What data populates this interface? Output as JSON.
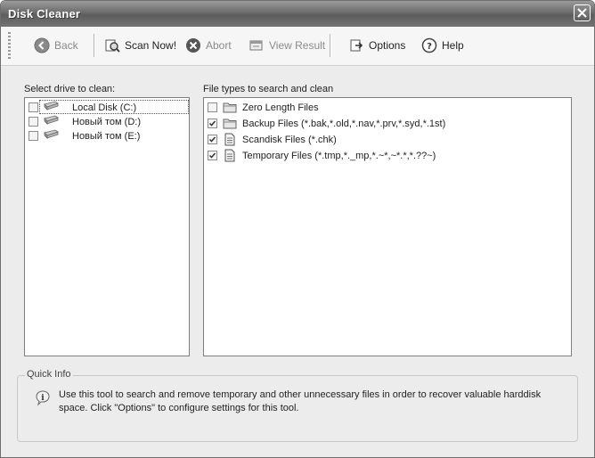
{
  "window": {
    "title": "Disk Cleaner"
  },
  "toolbar": {
    "back_label": "Back",
    "scan_label": "Scan Now!",
    "abort_label": "Abort",
    "view_label": "View Result",
    "options_label": "Options",
    "help_label": "Help"
  },
  "drives": {
    "label": "Select drive to clean:",
    "items": [
      {
        "label": "Local Disk (C:)",
        "checked": false
      },
      {
        "label": "Новый том (D:)",
        "checked": false
      },
      {
        "label": "Новый том (E:)",
        "checked": false
      }
    ]
  },
  "filetypes": {
    "label": "File types to search and clean",
    "items": [
      {
        "label": "Zero Length Files",
        "checked": false,
        "icon": "folder-icon"
      },
      {
        "label": "Backup Files (*.bak,*.old,*.nav,*.prv,*.syd,*.1st)",
        "checked": true,
        "icon": "folder-icon"
      },
      {
        "label": "Scandisk Files (*.chk)",
        "checked": true,
        "icon": "document-icon"
      },
      {
        "label": "Temporary Files (*.tmp,*._mp,*.~*,~*.*,*.??~)",
        "checked": true,
        "icon": "document-icon"
      }
    ]
  },
  "quickinfo": {
    "title": "Quick Info",
    "text": "Use this tool to search and remove temporary and other unnecessary files in order to recover valuable harddisk space. Click \"Options\" to configure settings for this tool."
  }
}
